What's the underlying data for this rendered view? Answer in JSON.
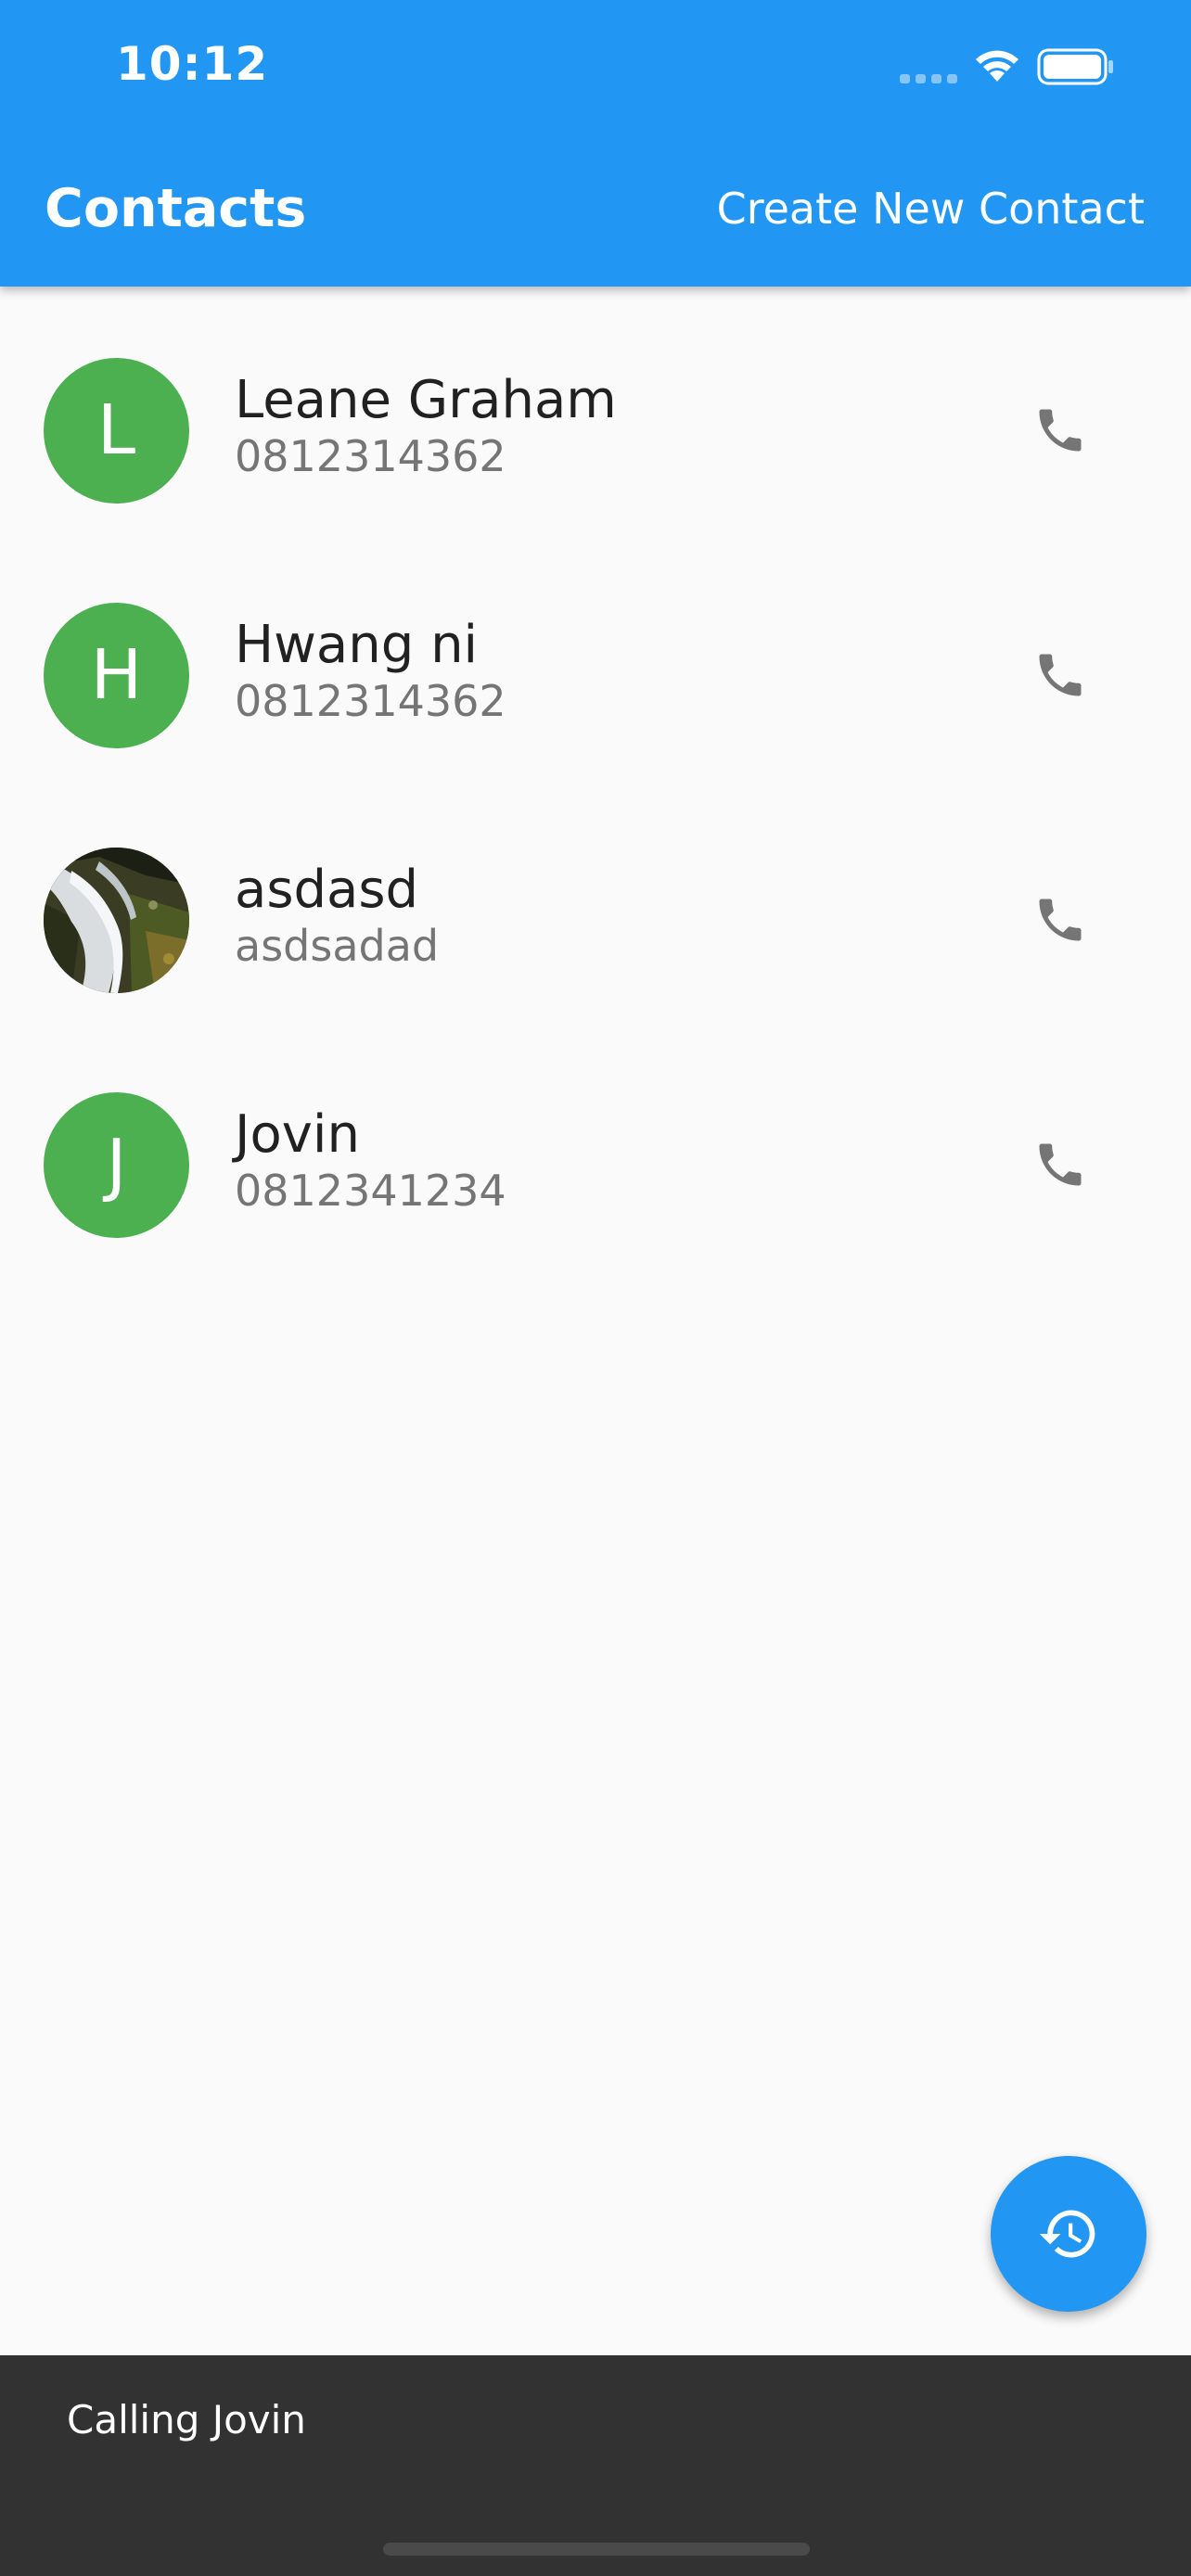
{
  "status_bar": {
    "time": "10:12"
  },
  "header": {
    "title": "Contacts",
    "action_label": "Create New Contact"
  },
  "colors": {
    "primary": "#2196f3",
    "avatar_green": "#4caf50",
    "snackbar": "#323232"
  },
  "contacts": [
    {
      "initial": "L",
      "name": "Leane Graham",
      "phone": "0812314362",
      "avatar": "letter"
    },
    {
      "initial": "H",
      "name": "Hwang ni",
      "phone": "0812314362",
      "avatar": "letter"
    },
    {
      "initial": "",
      "name": "asdasd",
      "phone": "asdsadad",
      "avatar": "waterfall-photo"
    },
    {
      "initial": "J",
      "name": "Jovin",
      "phone": "0812341234",
      "avatar": "letter"
    }
  ],
  "icons": {
    "call": "phone-icon",
    "fab": "history-icon",
    "wifi": "wifi-icon",
    "battery": "battery-icon"
  },
  "snackbar": {
    "message": "Calling Jovin"
  }
}
